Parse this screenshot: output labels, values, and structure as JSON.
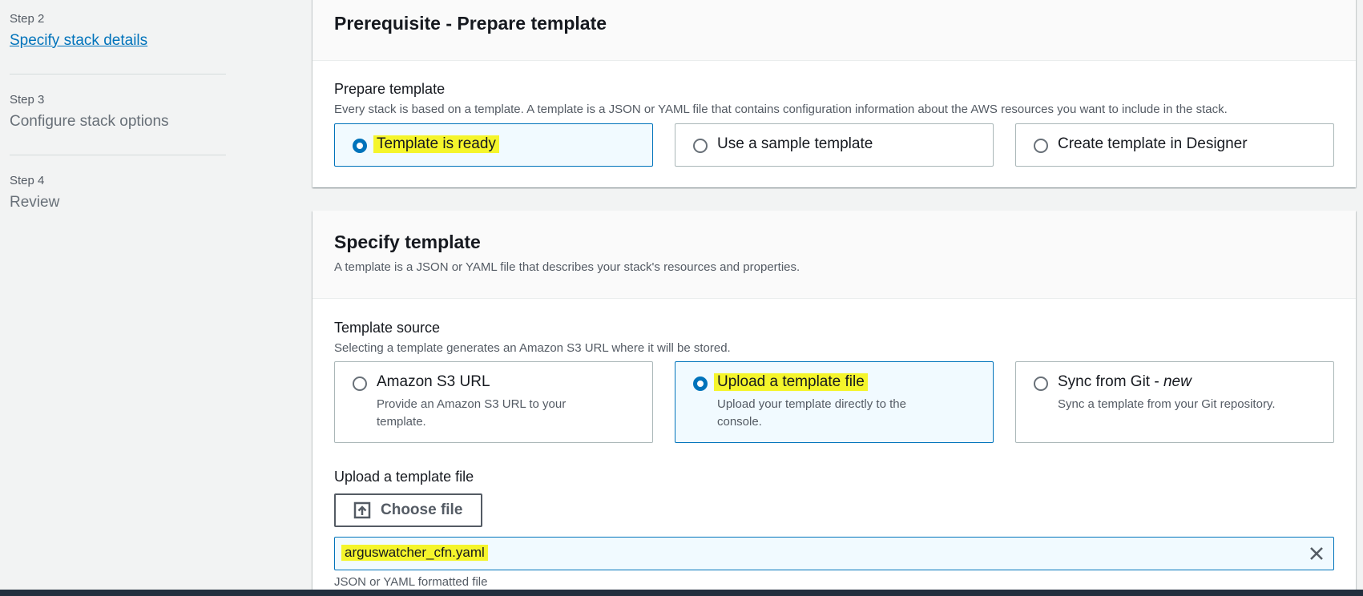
{
  "sidebar": {
    "steps": [
      {
        "num": "Step 2",
        "title": "Specify stack details",
        "active": true
      },
      {
        "num": "Step 3",
        "title": "Configure stack options",
        "active": false
      },
      {
        "num": "Step 4",
        "title": "Review",
        "active": false
      }
    ]
  },
  "prerequisite": {
    "title": "Prerequisite - Prepare template",
    "field_label": "Prepare template",
    "field_desc": "Every stack is based on a template. A template is a JSON or YAML file that contains configuration information about the AWS resources you want to include in the stack.",
    "options": [
      {
        "label": "Template is ready",
        "selected": true
      },
      {
        "label": "Use a sample template",
        "selected": false
      },
      {
        "label": "Create template in Designer",
        "selected": false
      }
    ]
  },
  "specify": {
    "title": "Specify template",
    "desc": "A template is a JSON or YAML file that describes your stack's resources and properties.",
    "source_label": "Template source",
    "source_desc": "Selecting a template generates an Amazon S3 URL where it will be stored.",
    "options": [
      {
        "label": "Amazon S3 URL",
        "sub_line1": "Provide an Amazon S3 URL to your",
        "sub_line2": "template.",
        "selected": false
      },
      {
        "label": "Upload a template file",
        "sub_line1": "Upload your template directly to the",
        "sub_line2": "console.",
        "selected": true
      },
      {
        "label": "Sync from Git - ",
        "label_suffix": "new",
        "sub_line1": "Sync a template from your Git repository.",
        "selected": false
      }
    ],
    "upload_label": "Upload a template file",
    "choose_button": "Choose file",
    "file_name": "arguswatcher_cfn.yaml",
    "file_hint": "JSON or YAML formatted file"
  },
  "colors": {
    "accent": "#0073bb",
    "highlight": "#f5f52b",
    "page_bg": "#f2f3f3"
  },
  "icons": [
    "upload-icon",
    "close-icon",
    "radio-icon"
  ]
}
